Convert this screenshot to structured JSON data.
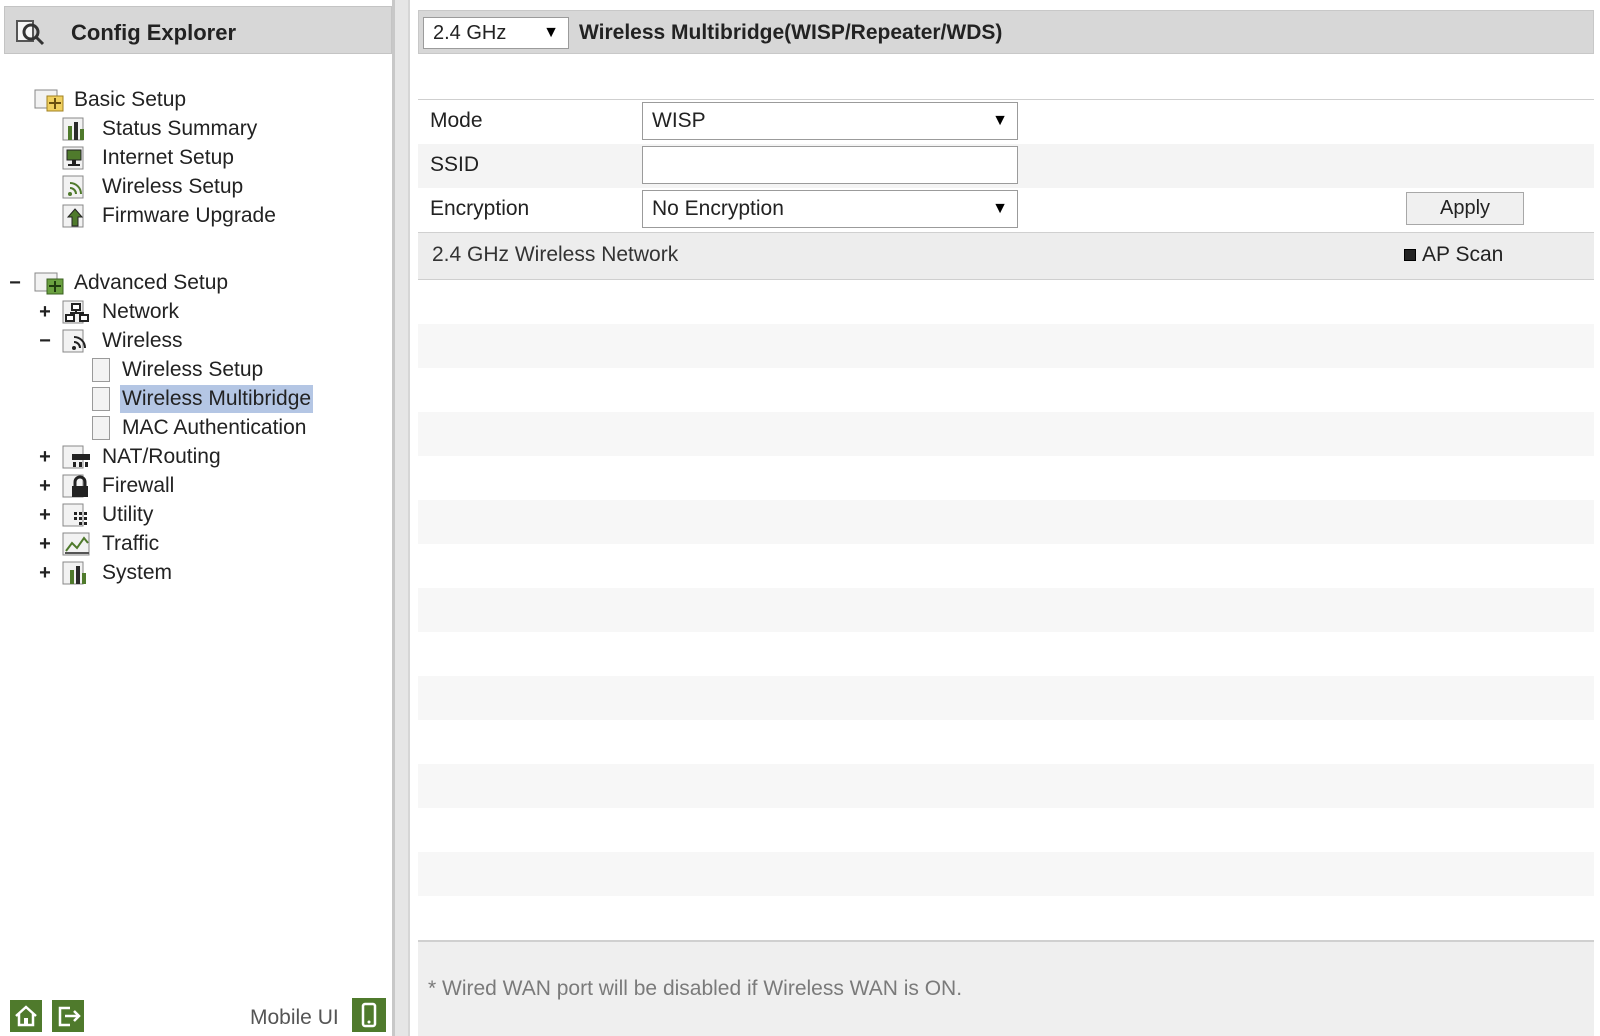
{
  "explorer": {
    "title": "Config Explorer"
  },
  "tree": {
    "basic_setup": "Basic Setup",
    "status_summary": "Status Summary",
    "internet_setup": "Internet Setup",
    "wireless_setup_basic": "Wireless Setup",
    "firmware_upgrade": "Firmware Upgrade",
    "advanced_setup": "Advanced Setup",
    "network": "Network",
    "wireless": "Wireless",
    "wireless_setup_adv": "Wireless Setup",
    "wireless_multibridge": "Wireless Multibridge",
    "mac_authentication": "MAC Authentication",
    "nat_routing": "NAT/Routing",
    "firewall": "Firewall",
    "utility": "Utility",
    "traffic": "Traffic",
    "system": "System",
    "expand_symbol": "+",
    "collapse_symbol": "−"
  },
  "left_footer": {
    "mobile_ui": "Mobile UI"
  },
  "header": {
    "band_value": "2.4 GHz",
    "title": "Wireless Multibridge(WISP/Repeater/WDS)"
  },
  "form": {
    "mode_label": "Mode",
    "mode_value": "WISP",
    "ssid_label": "SSID",
    "ssid_value": "",
    "encryption_label": "Encryption",
    "encryption_value": "No Encryption",
    "apply_label": "Apply"
  },
  "network_list": {
    "title": "2.4 GHz Wireless Network",
    "ap_scan_label": "AP Scan"
  },
  "footer": {
    "note": "* Wired WAN port will be disabled if Wireless WAN is ON."
  },
  "colors": {
    "accent_green": "#4f7a2c",
    "selection": "#b4c6e4",
    "header_gray": "#d7d7d7"
  }
}
